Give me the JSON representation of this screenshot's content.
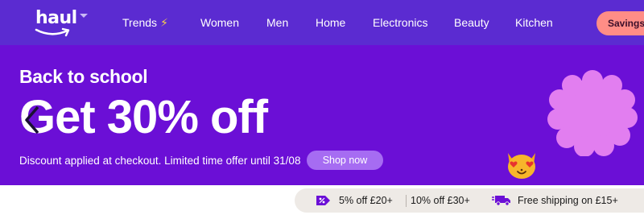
{
  "nav": {
    "logo_text": "haul",
    "items": [
      {
        "label": "Trends",
        "emoji": "⚡"
      },
      {
        "label": "Women"
      },
      {
        "label": "Men"
      },
      {
        "label": "Home"
      },
      {
        "label": "Electronics"
      },
      {
        "label": "Beauty"
      },
      {
        "label": "Kitchen"
      }
    ],
    "savings_label": "Savings s"
  },
  "banner": {
    "subtitle": "Back to school",
    "title": "Get 30% off",
    "description": "Discount applied at checkout. Limited time offer until 31/08",
    "cta_label": "Shop now"
  },
  "perks": {
    "items": [
      {
        "label": "5% off £20+",
        "icon": "discount-tag-icon"
      },
      {
        "label": "10% off £30+"
      },
      {
        "label": "Free shipping on £15+",
        "icon": "delivery-truck-icon"
      }
    ]
  },
  "colors": {
    "nav_bg": "#5b2bd1",
    "banner_bg": "#6b0fd6",
    "cta_bg": "#a66cf2",
    "savings_bg": "#ff8d86",
    "blob": "#e27ef0",
    "perks_bg": "#eeeae6",
    "perk_icon": "#6b0fd6"
  }
}
